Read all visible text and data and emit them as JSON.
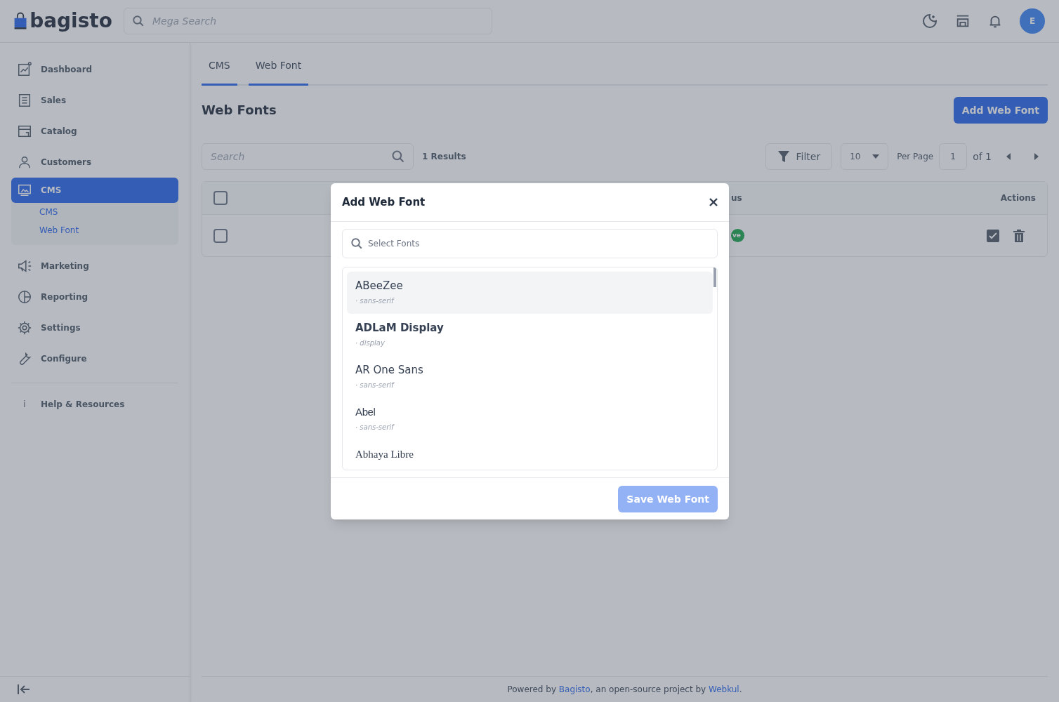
{
  "header": {
    "logo": "bagisto",
    "search_placeholder": "Mega Search",
    "avatar": "E"
  },
  "sidebar": {
    "items": [
      {
        "label": "Dashboard",
        "selected": false
      },
      {
        "label": "Sales",
        "selected": false
      },
      {
        "label": "Catalog",
        "selected": false
      },
      {
        "label": "Customers",
        "selected": false
      },
      {
        "label": "CMS",
        "selected": true,
        "children": [
          {
            "label": "CMS"
          },
          {
            "label": "Web Font"
          }
        ]
      },
      {
        "label": "Marketing",
        "selected": false
      },
      {
        "label": "Reporting",
        "selected": false
      },
      {
        "label": "Settings",
        "selected": false
      },
      {
        "label": "Configure",
        "selected": false
      }
    ],
    "help": {
      "icon": "i",
      "label": "Help & Resources"
    }
  },
  "tabs": [
    {
      "label": "CMS",
      "selected": true
    },
    {
      "label": "Web Font",
      "selected": true
    }
  ],
  "page_title": "Web Fonts",
  "add_button": "Add Web Font",
  "toolbar": {
    "search_placeholder": "Search",
    "results": "1 Results",
    "filter": "Filter",
    "per_page_value": "10",
    "per_page_label": "Per Page",
    "page": "1",
    "page_total": "of 1"
  },
  "table": {
    "header_checked": false,
    "columns": [
      {
        "label": "us"
      },
      {
        "label": "Actions"
      }
    ],
    "rows": [
      {
        "checked": false,
        "status": "ve"
      }
    ]
  },
  "modal": {
    "title": "Add Web Font",
    "search_placeholder": "Select Fonts",
    "save_button": "Save Web Font",
    "fonts": [
      {
        "name": "ABeeZee",
        "category": "· sans-serif",
        "kind": "regular",
        "selected": true
      },
      {
        "name": "ADLaM Display",
        "category": "· display",
        "kind": "bold",
        "selected": false
      },
      {
        "name": "AR One Sans",
        "category": "· sans-serif",
        "kind": "regular",
        "selected": false
      },
      {
        "name": "Abel",
        "category": "· sans-serif",
        "kind": "condensed",
        "selected": false
      },
      {
        "name": "Abhaya Libre",
        "kind": "serif",
        "selected": false
      }
    ]
  },
  "footer": {
    "prefix": "Powered by ",
    "link_1": "Bagisto",
    "middle": ", an open-source project by ",
    "link_2": "Webkul",
    "suffix": "."
  }
}
